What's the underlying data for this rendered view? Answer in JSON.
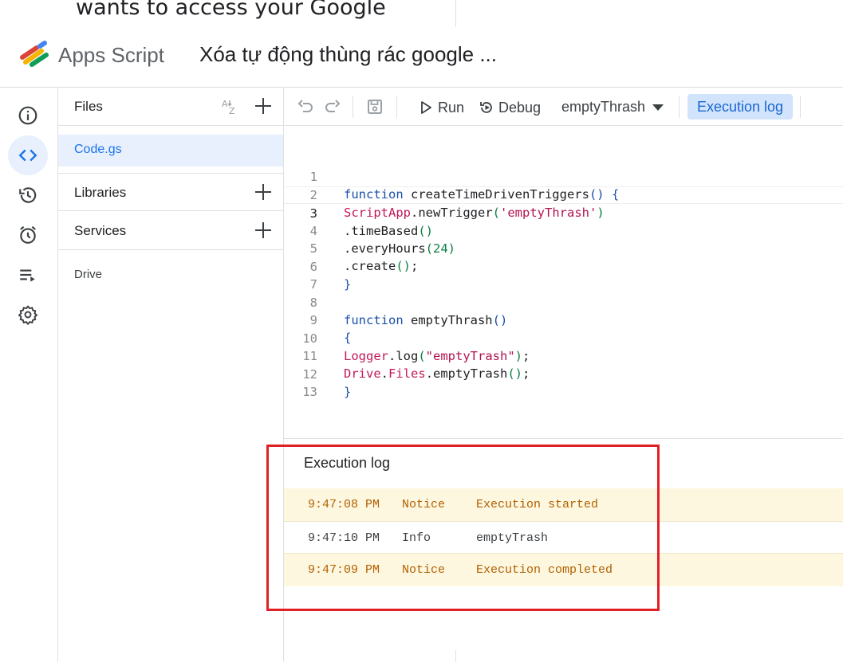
{
  "top_notice": {
    "text": "wants to access your Google"
  },
  "header": {
    "app_name": "Apps Script",
    "project_title": "Xóa tự động thùng rác google ..."
  },
  "rail": {
    "items": [
      {
        "icon": "info-icon",
        "active": false
      },
      {
        "icon": "code-icon",
        "active": true
      },
      {
        "icon": "history-icon",
        "active": false
      },
      {
        "icon": "alarm-icon",
        "active": false
      },
      {
        "icon": "executions-icon",
        "active": false
      },
      {
        "icon": "gear-icon",
        "active": false
      }
    ]
  },
  "files_panel": {
    "files_label": "Files",
    "sort_icon": "sort-az-icon",
    "files": [
      {
        "name": "Code.gs",
        "selected": true
      }
    ],
    "libraries_label": "Libraries",
    "services_label": "Services",
    "services": [
      {
        "name": "Drive"
      }
    ]
  },
  "toolbar": {
    "run_label": "Run",
    "debug_label": "Debug",
    "selected_function": "emptyThrash",
    "execution_log_label": "Execution log"
  },
  "editor": {
    "current_line": 3,
    "lines": [
      {
        "number": "1",
        "text": "function createTimeDrivenTriggers() {"
      },
      {
        "number": "2",
        "text": "ScriptApp.newTrigger('emptyThrash')"
      },
      {
        "number": "3",
        "text": ".timeBased()"
      },
      {
        "number": "4",
        "text": ".everyHours(24)"
      },
      {
        "number": "5",
        "text": ".create();"
      },
      {
        "number": "6",
        "text": "}"
      },
      {
        "number": "7",
        "text": ""
      },
      {
        "number": "8",
        "text": "function emptyThrash()"
      },
      {
        "number": "9",
        "text": "{"
      },
      {
        "number": "10",
        "text": "Logger.log(\"emptyTrash\");"
      },
      {
        "number": "11",
        "text": "Drive.Files.emptyTrash();"
      },
      {
        "number": "12",
        "text": "}"
      },
      {
        "number": "13",
        "text": ""
      }
    ]
  },
  "execution_log": {
    "title": "Execution log",
    "entries": [
      {
        "time": "9:47:08 PM",
        "level": "Notice",
        "message": "Execution started"
      },
      {
        "time": "9:47:10 PM",
        "level": "Info",
        "message": "emptyTrash"
      },
      {
        "time": "9:47:09 PM",
        "level": "Notice",
        "message": "Execution completed"
      }
    ]
  },
  "colors": {
    "accent": "#1a73e8",
    "notice_bg": "#fef7e0",
    "notice_text": "#b06000",
    "highlight_box": "#e02027"
  }
}
